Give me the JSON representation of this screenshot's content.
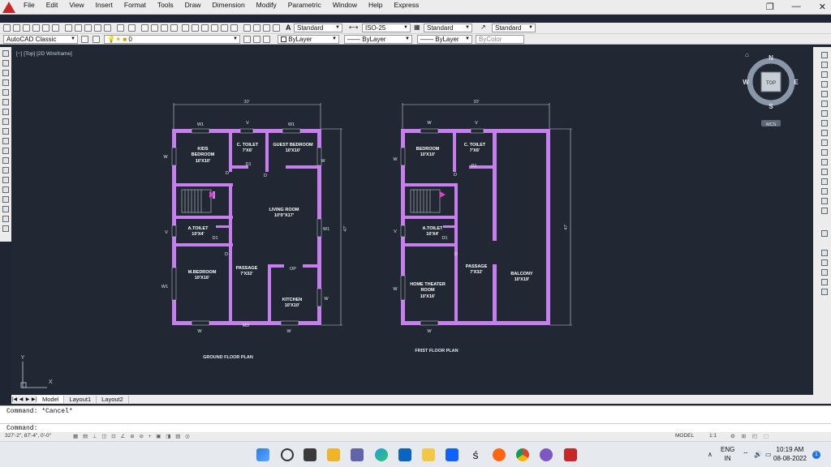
{
  "menu": [
    "File",
    "Edit",
    "View",
    "Insert",
    "Format",
    "Tools",
    "Draw",
    "Dimension",
    "Modify",
    "Parametric",
    "Window",
    "Help",
    "Express"
  ],
  "window_controls": [
    "❐",
    "—",
    "✕"
  ],
  "styles_toolbar": {
    "text_style": "Standard",
    "dim_style": "ISO-25",
    "table_style": "Standard",
    "multileader_style": "Standard"
  },
  "workspace": "AutoCAD Classic",
  "layer": "0",
  "props": {
    "color": "ByLayer",
    "linetype": "ByLayer",
    "lineweight": "ByLayer",
    "plotstyle": "ByColor"
  },
  "view_label": "[−] [Top] [2D Wireframe]",
  "viewcube": {
    "top": "TOP",
    "n": "N",
    "s": "S",
    "e": "E",
    "w": "W",
    "ucs": "WCS"
  },
  "ground": {
    "overall_width": "30'",
    "overall_depth": "47'",
    "title": "GROUND FLOOR PLAN",
    "rooms": [
      {
        "name": "KIDS",
        "name2": "BEDROOM",
        "size": "10'X10'"
      },
      {
        "name": "C. TOILET",
        "size": "7'X6'"
      },
      {
        "name": "GUEST BEDROOM",
        "size": "10'X10'"
      },
      {
        "name": "LIVING ROOM",
        "size": "10'9\"X17'"
      },
      {
        "name": "A.TOILET",
        "size": "10'X4'"
      },
      {
        "name": "M.BEDROOM",
        "size": "10'X16'"
      },
      {
        "name": "PASSAGE",
        "size": "7'X32'"
      },
      {
        "name": "KITCHEN",
        "size": "10'X10'"
      }
    ],
    "tags": {
      "w1a": "W1",
      "v": "V",
      "w1b": "W1",
      "wl": "W",
      "wr": "W",
      "d1": "D1",
      "d_a": "D",
      "d_b": "D",
      "vl": "V",
      "w1r": "W1",
      "d1b": "D1",
      "d_c": "D",
      "op": "OP",
      "w1l": "W1",
      "wr2": "W",
      "wb": "W",
      "md": "MD",
      "wb2": "W"
    }
  },
  "first": {
    "overall_width": "30'",
    "overall_depth": "47'",
    "title": "FRIST FLOOR PLAN",
    "rooms": [
      {
        "name": "BEDROOM",
        "size": "10'X10'"
      },
      {
        "name": "C. TOILET",
        "size": "7'X6'"
      },
      {
        "name": "A.TOILET",
        "size": "10'X4'"
      },
      {
        "name": "PASSAGE",
        "size": "7'X32'"
      },
      {
        "name": "BALCONY",
        "size": "10'X19'"
      },
      {
        "name": "HOME THEATER",
        "name2": "ROOM",
        "size": "10'X16'"
      }
    ],
    "tags": {
      "w": "W",
      "v": "V",
      "wl": "W",
      "d1": "D1",
      "d": "D",
      "vl": "V",
      "d1b": "D1",
      "d_b": "D",
      "wl2": "W",
      "wb": "W"
    }
  },
  "ucs_axes": {
    "y": "Y",
    "x": "X"
  },
  "tabs": [
    "Model",
    "Layout1",
    "Layout2"
  ],
  "command_history": "Command: *Cancel*",
  "command_prompt": "Command:",
  "coords": "327'-2\", 87'-4\", 0'-0\"",
  "status_right": {
    "model": "MODEL",
    "scale": "1:1"
  },
  "clock": {
    "lang": "ENG",
    "region": "IN",
    "time": "10:19 AM",
    "date": "08-08-2022"
  },
  "colors": {
    "wall": "#c77ff0",
    "canvas": "#212833",
    "dim": "#c9d2dc"
  }
}
